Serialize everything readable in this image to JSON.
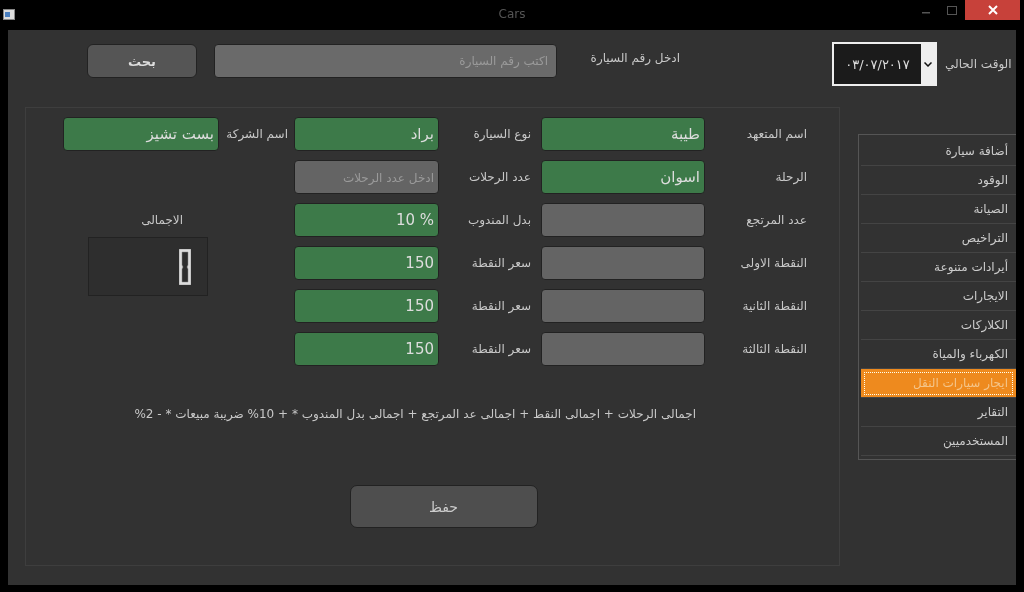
{
  "window": {
    "title": "Cars"
  },
  "search": {
    "button": "بحث",
    "placeholder": "اكتب رقم السيارة",
    "label": "ادخل رقم السيارة"
  },
  "current_time": {
    "label": "الوقت الحالي",
    "value": "٠٣/٠٧/٢٠١٧"
  },
  "form": {
    "rows": [
      {
        "right": {
          "label": "اسم المتعهد",
          "field": {
            "value": "طيبة",
            "highlighted": true
          }
        },
        "middle": {
          "label": "نوع السيارة",
          "field": {
            "value": "براد",
            "highlighted": true
          }
        },
        "left": {
          "label": "اسم الشركة",
          "field": {
            "value": "بست تشيز",
            "highlighted": true
          }
        }
      },
      {
        "right": {
          "label": "الرحلة",
          "field": {
            "value": "اسوان",
            "highlighted": true
          }
        },
        "middle": {
          "label": "عدد الرحلات",
          "field": {
            "placeholder": "ادخل عدد الرحلات",
            "highlighted": false
          }
        }
      },
      {
        "right": {
          "label": "عدد المرتجع",
          "field": {
            "highlighted": false
          }
        },
        "middle": {
          "label": "بدل المندوب",
          "field": {
            "value": "10 %",
            "highlighted": true
          }
        }
      },
      {
        "right": {
          "label": "النقطة الاولى",
          "field": {
            "highlighted": false
          }
        },
        "middle": {
          "label": "سعر النقطة",
          "field": {
            "value": "150",
            "highlighted": true
          }
        }
      },
      {
        "right": {
          "label": "النقطة الثانية",
          "field": {
            "highlighted": false
          }
        },
        "middle": {
          "label": "سعر النقطة",
          "field": {
            "value": "150",
            "highlighted": true
          }
        }
      },
      {
        "right": {
          "label": "النقطة الثالثة",
          "field": {
            "highlighted": false
          }
        },
        "middle": {
          "label": "سعر النقطة",
          "field": {
            "value": "150",
            "highlighted": true
          }
        }
      }
    ],
    "total": {
      "label": "الاجمالى"
    },
    "formula": "اجمالى الرحلات + اجمالى النقط + اجمالى عد المرتجع + اجمالى بدل المندوب  * + 10% ضريبة مبيعات * - 2%",
    "save_button": "حفظ"
  },
  "sidebar": {
    "items": [
      {
        "label": "أضافة سيارة",
        "selected": false
      },
      {
        "label": "الوقود",
        "selected": false
      },
      {
        "label": "الصيانة",
        "selected": false
      },
      {
        "label": "التراخيص",
        "selected": false
      },
      {
        "label": "أيرادات متنوعة",
        "selected": false
      },
      {
        "label": "الايجارات",
        "selected": false
      },
      {
        "label": "الكلاركات",
        "selected": false
      },
      {
        "label": "الكهرباء والمياة",
        "selected": false
      },
      {
        "label": "ايجار سيارات النقل",
        "selected": true
      },
      {
        "label": "التقاير",
        "selected": false
      },
      {
        "label": "المستخدميين",
        "selected": false
      }
    ]
  }
}
